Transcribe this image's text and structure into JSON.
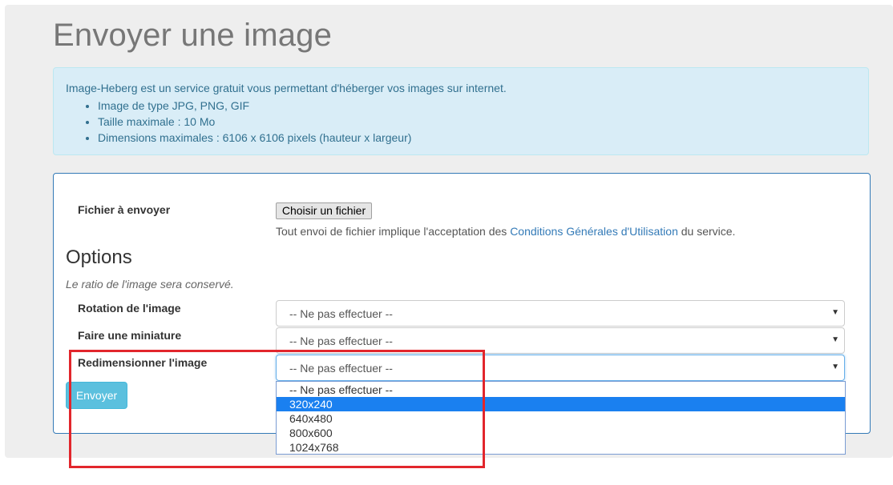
{
  "page": {
    "title": "Envoyer une image"
  },
  "info": {
    "intro": "Image-Heberg est un service gratuit vous permettant d'héberger vos images sur internet.",
    "items": [
      "Image de type JPG, PNG, GIF",
      "Taille maximale : 10 Mo",
      "Dimensions maximales : 6106 x 6106 pixels (hauteur x largeur)"
    ]
  },
  "form": {
    "file_label": "Fichier à envoyer",
    "file_button": "Choisir un fichier",
    "terms_prefix": "Tout envoi de fichier implique l'acceptation des ",
    "terms_link": "Conditions Générales d'Utilisation",
    "terms_suffix": " du service.",
    "options_heading": "Options",
    "ratio_note": "Le ratio de l'image sera conservé.",
    "rotation": {
      "label": "Rotation de l'image",
      "value": "-- Ne pas effectuer --"
    },
    "thumbnail": {
      "label": "Faire une miniature",
      "value": "-- Ne pas effectuer --"
    },
    "resize": {
      "label": "Redimensionner l'image",
      "value": "-- Ne pas effectuer --",
      "options": [
        "-- Ne pas effectuer --",
        "320x240",
        "640x480",
        "800x600",
        "1024x768"
      ],
      "highlighted": "320x240"
    },
    "submit": "Envoyer",
    "caret": "▼"
  },
  "colors": {
    "info_bg": "#d9edf7",
    "info_text": "#31708f",
    "panel_border": "#337ab7",
    "submit_bg": "#5bc0de",
    "option_highlight": "#1a80f0",
    "annotation_frame": "#e2262c"
  }
}
